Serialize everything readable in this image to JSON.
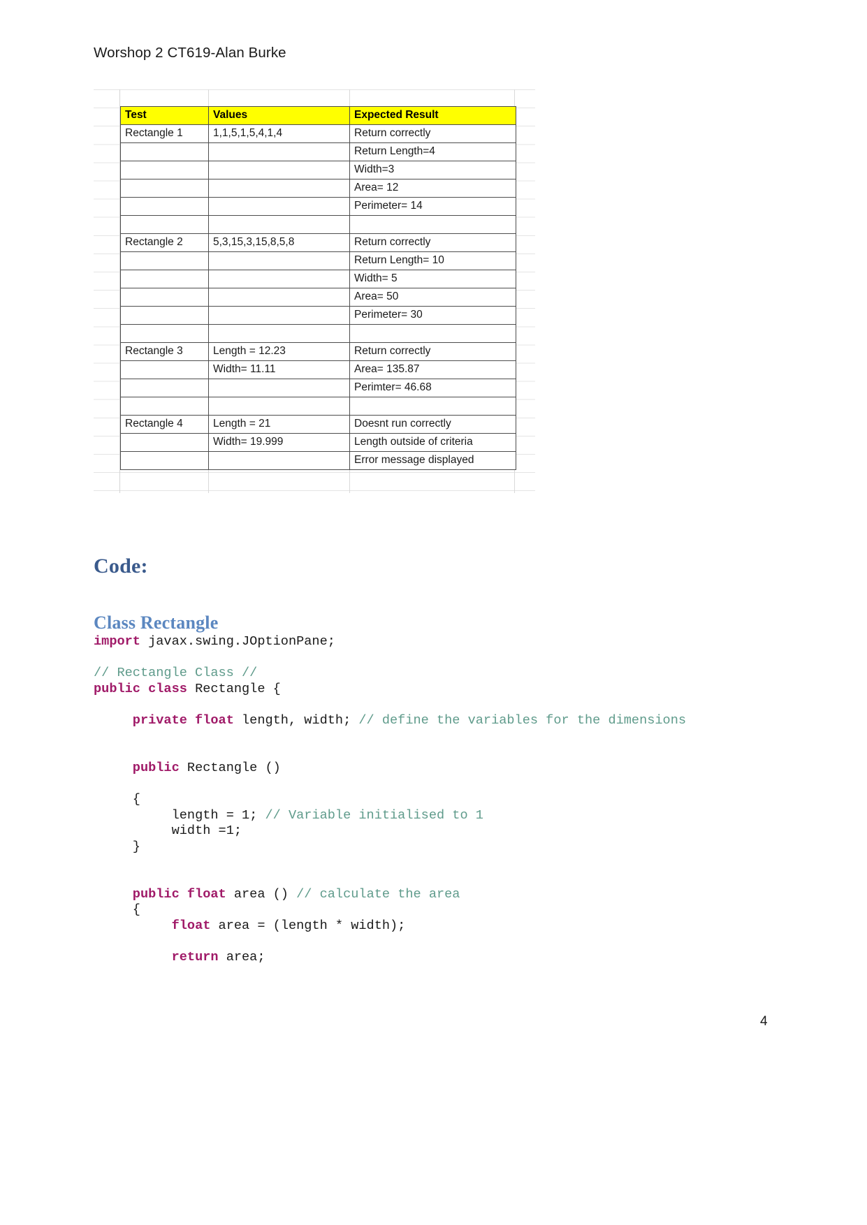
{
  "document": {
    "header": "Worshop 2 CT619-Alan Burke",
    "page_number": "4"
  },
  "test_table": {
    "columns": [
      "Test",
      "Values",
      "Expected Result"
    ],
    "rows": [
      {
        "test": "Rectangle 1",
        "values": "1,1,5,1,5,4,1,4",
        "expected": "Return correctly"
      },
      {
        "test": "",
        "values": "",
        "expected": "Return Length=4"
      },
      {
        "test": "",
        "values": "",
        "expected": "Width=3"
      },
      {
        "test": "",
        "values": "",
        "expected": "Area= 12"
      },
      {
        "test": "",
        "values": "",
        "expected": "Perimeter= 14"
      },
      {
        "test": "",
        "values": "",
        "expected": ""
      },
      {
        "test": "Rectangle 2",
        "values": "5,3,15,3,15,8,5,8",
        "expected": "Return correctly"
      },
      {
        "test": "",
        "values": "",
        "expected": "Return Length= 10"
      },
      {
        "test": "",
        "values": "",
        "expected": "Width= 5"
      },
      {
        "test": "",
        "values": "",
        "expected": "Area= 50"
      },
      {
        "test": "",
        "values": "",
        "expected": "Perimeter= 30"
      },
      {
        "test": "",
        "values": "",
        "expected": ""
      },
      {
        "test": "Rectangle 3",
        "values": "Length = 12.23",
        "expected": "Return correctly"
      },
      {
        "test": "",
        "values": "Width= 11.11",
        "expected": "Area= 135.87"
      },
      {
        "test": "",
        "values": "",
        "expected": "Perimter= 46.68"
      },
      {
        "test": "",
        "values": "",
        "expected": ""
      },
      {
        "test": "Rectangle 4",
        "values": "Length = 21",
        "expected": "Doesnt run correctly"
      },
      {
        "test": "",
        "values": "Width= 19.999",
        "expected": "Length outside of criteria"
      },
      {
        "test": "",
        "values": "",
        "expected": "Error message displayed"
      }
    ],
    "header_fill": "#ffff00"
  },
  "headings": {
    "code": "Code:",
    "class_rectangle": "Class Rectangle",
    "code_color": "#3a5a8c",
    "class_color": "#5b87c0"
  },
  "code_listing": {
    "keyword_color": "#a01a68",
    "comment_color": "#5f9b8b",
    "lines": [
      [
        {
          "t": "import",
          "c": "kw"
        },
        {
          "t": " javax.swing.JOptionPane;",
          "c": "pl"
        }
      ],
      [
        {
          "t": "",
          "c": "pl"
        }
      ],
      [
        {
          "t": "// Rectangle Class //",
          "c": "cm"
        }
      ],
      [
        {
          "t": "public class",
          "c": "kw"
        },
        {
          "t": " Rectangle {",
          "c": "pl"
        }
      ],
      [
        {
          "t": "",
          "c": "pl"
        }
      ],
      [
        {
          "t": "     ",
          "c": "pl"
        },
        {
          "t": "private float",
          "c": "kw"
        },
        {
          "t": " length, width; ",
          "c": "pl"
        },
        {
          "t": "// define the variables for the dimensions",
          "c": "cm"
        }
      ],
      [
        {
          "t": "",
          "c": "pl"
        }
      ],
      [
        {
          "t": "",
          "c": "pl"
        }
      ],
      [
        {
          "t": "     ",
          "c": "pl"
        },
        {
          "t": "public",
          "c": "kw"
        },
        {
          "t": " Rectangle ()",
          "c": "pl"
        }
      ],
      [
        {
          "t": "",
          "c": "pl"
        }
      ],
      [
        {
          "t": "     {",
          "c": "pl"
        }
      ],
      [
        {
          "t": "          length = 1; ",
          "c": "pl"
        },
        {
          "t": "// Variable initialised to 1",
          "c": "cm"
        }
      ],
      [
        {
          "t": "          width =1;",
          "c": "pl"
        }
      ],
      [
        {
          "t": "     }",
          "c": "pl"
        }
      ],
      [
        {
          "t": "",
          "c": "pl"
        }
      ],
      [
        {
          "t": "",
          "c": "pl"
        }
      ],
      [
        {
          "t": "     ",
          "c": "pl"
        },
        {
          "t": "public float",
          "c": "kw"
        },
        {
          "t": " area () ",
          "c": "pl"
        },
        {
          "t": "// calculate the area",
          "c": "cm"
        }
      ],
      [
        {
          "t": "     {",
          "c": "pl"
        }
      ],
      [
        {
          "t": "          ",
          "c": "pl"
        },
        {
          "t": "float",
          "c": "kw"
        },
        {
          "t": " area = (length * width);",
          "c": "pl"
        }
      ],
      [
        {
          "t": "",
          "c": "pl"
        }
      ],
      [
        {
          "t": "          ",
          "c": "pl"
        },
        {
          "t": "return",
          "c": "kw"
        },
        {
          "t": " area;",
          "c": "pl"
        }
      ]
    ]
  }
}
